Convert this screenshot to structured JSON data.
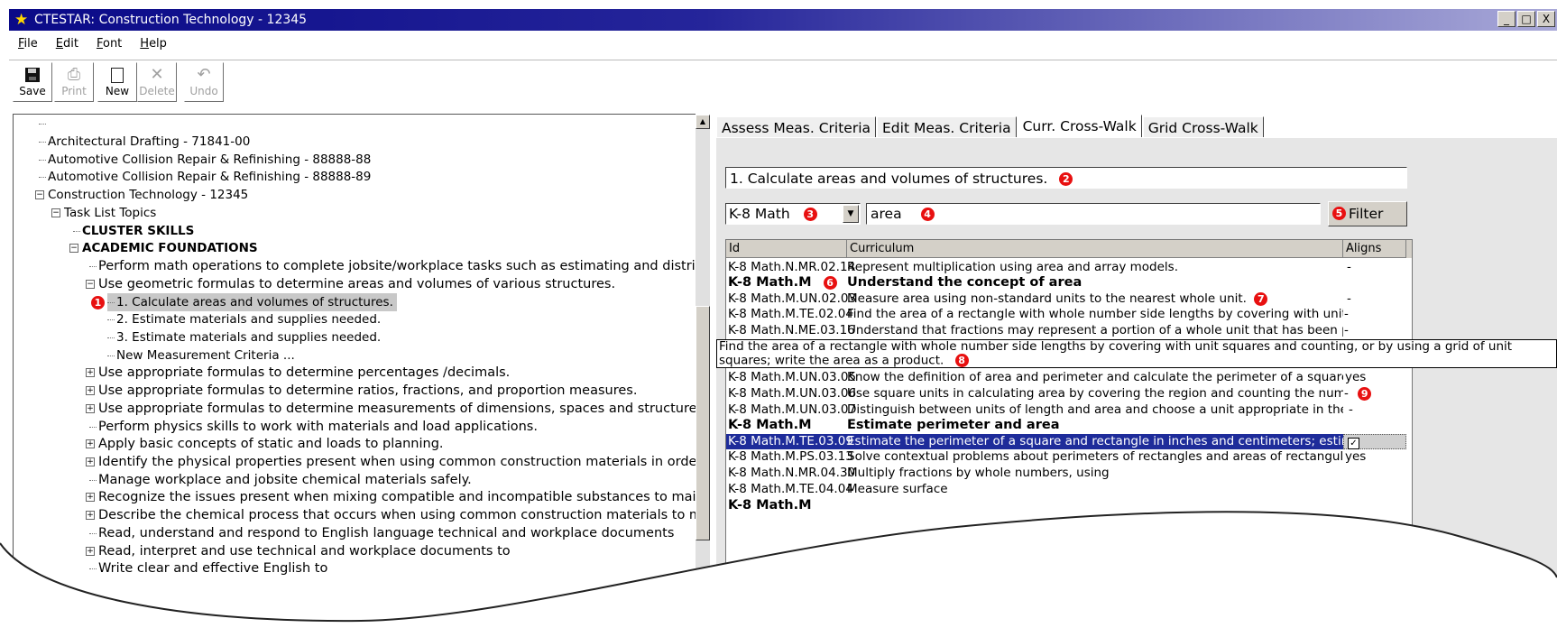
{
  "window": {
    "title": "CTESTAR: Construction Technology - 12345",
    "controls": [
      "_",
      "□",
      "X"
    ]
  },
  "menu": [
    {
      "acc": "F",
      "rest": "ile"
    },
    {
      "acc": "E",
      "rest": "dit"
    },
    {
      "acc": "F",
      "rest": "ont"
    },
    {
      "acc": "H",
      "rest": "elp"
    }
  ],
  "toolbar": {
    "save": "Save",
    "print": "Print",
    "new": "New",
    "delete": "Delete",
    "undo": "Undo"
  },
  "tree": {
    "items": [
      "Architectural Drafting - 71841-00",
      "Automotive Collision Repair & Refinishing - 88888-88",
      "Automotive Collision Repair & Refinishing - 88888-89",
      "Construction Technology - 12345",
      "Task List Topics",
      "CLUSTER SKILLS",
      "ACADEMIC FOUNDATIONS",
      "Perform math operations to complete jobsite/workplace tasks such as estimating and distributing",
      "Use geometric formulas to determine areas and volumes of various structures.",
      "1. Calculate areas and volumes of structures.",
      "2. Estimate materials and supplies needed.",
      "3. Estimate materials and supplies needed.",
      "New Measurement Criteria ...",
      "Use appropriate formulas to determine percentages /decimals.",
      "Use appropriate formulas to determine ratios, fractions, and proportion measures.",
      "Use appropriate formulas to determine measurements of dimensions, spaces and structures.",
      "Perform physics skills to work with materials and load applications.",
      "Apply basic concepts of static and loads to planning.",
      "Identify the physical properties present when using common construction materials in order to us",
      "Manage workplace and jobsite chemical materials safely.",
      "Recognize the issues present when mixing compatible and incompatible substances to maintain wo",
      "Describe the chemical process that occurs when using common construction materials to maintain",
      "Read, understand and respond to English language technical and workplace documents",
      "Read, interpret and use technical and workplace documents to",
      "Write clear and effective English to"
    ]
  },
  "tabs": [
    "Assess Meas. Criteria",
    "Edit Meas. Criteria",
    "Curr. Cross-Walk",
    "Grid Cross-Walk"
  ],
  "crosswalk": {
    "task": "1. Calculate areas and volumes of structures.",
    "curriculum_select": "K-8 Math",
    "search_value": "area",
    "filter_label": "Filter",
    "columns": {
      "id": "Id",
      "curriculum": "Curriculum",
      "aligns": "Aligns"
    },
    "rows": [
      {
        "id": "K-8 Math.N.MR.02.14",
        "desc": "Represent multiplication using area and array models.",
        "align": "-"
      },
      {
        "id": "K-8 Math.M",
        "desc": "Understand the concept of area",
        "align": ""
      },
      {
        "id": "K-8 Math.M.UN.02.03",
        "desc": "Measure area using non-standard units to the nearest whole unit.",
        "align": "-"
      },
      {
        "id": "K-8 Math.M.TE.02.04",
        "desc": "Find the area of a rectangle with whole number side lengths by covering with unit squares ...",
        "align": "-"
      },
      {
        "id": "K-8 Math.N.ME.03.16",
        "desc": "Understand that fractions may represent a portion of a whole unit that has been partitione...",
        "align": "-"
      },
      {
        "id": "K-8 Math.M.UN.03.05",
        "desc": "Know the definition of area and perimeter and calculate the perimeter of a square and rect...",
        "align": "yes"
      },
      {
        "id": "K-8 Math.M.UN.03.06",
        "desc": "Use square units in calculating area by covering the region and counting the number of sq...",
        "align": "-"
      },
      {
        "id": "K-8 Math.M.UN.03.07",
        "desc": "Distinguish between units of length and area and choose a unit appropriate in the context.",
        "align": "-"
      },
      {
        "id": "K-8 Math.M",
        "desc": "Estimate perimeter and area",
        "align": ""
      },
      {
        "id": "K-8 Math.M.TE.03.09",
        "desc": "Estimate the perimeter of a square and rectangle in inches and centimeters; estimate the a...",
        "align": "✓"
      },
      {
        "id": "K-8 Math.M.PS.03.13",
        "desc": "Solve contextual problems about perimeters of rectangles and areas of rectangular regions.",
        "align": "yes"
      },
      {
        "id": "K-8 Math.N.MR.04.30",
        "desc": "Multiply fractions by whole numbers, using",
        "align": ""
      },
      {
        "id": "K-8 Math.M.TE.04.04",
        "desc": "Measure surface",
        "align": ""
      },
      {
        "id": "K-8 Math.M",
        "desc": "",
        "align": ""
      }
    ],
    "tooltip": "Find the area of a rectangle with whole number side lengths by covering with unit squares and counting, or by using a grid of unit squares; write the area as a product."
  },
  "markers": [
    "1",
    "2",
    "3",
    "4",
    "5",
    "6",
    "7",
    "8",
    "9"
  ],
  "colors": {
    "title_start": "#0a0a88",
    "title_end": "#a9a9d8",
    "selection": "#1e2c9a",
    "marker": "#e81010",
    "face": "#d4d0c8"
  }
}
